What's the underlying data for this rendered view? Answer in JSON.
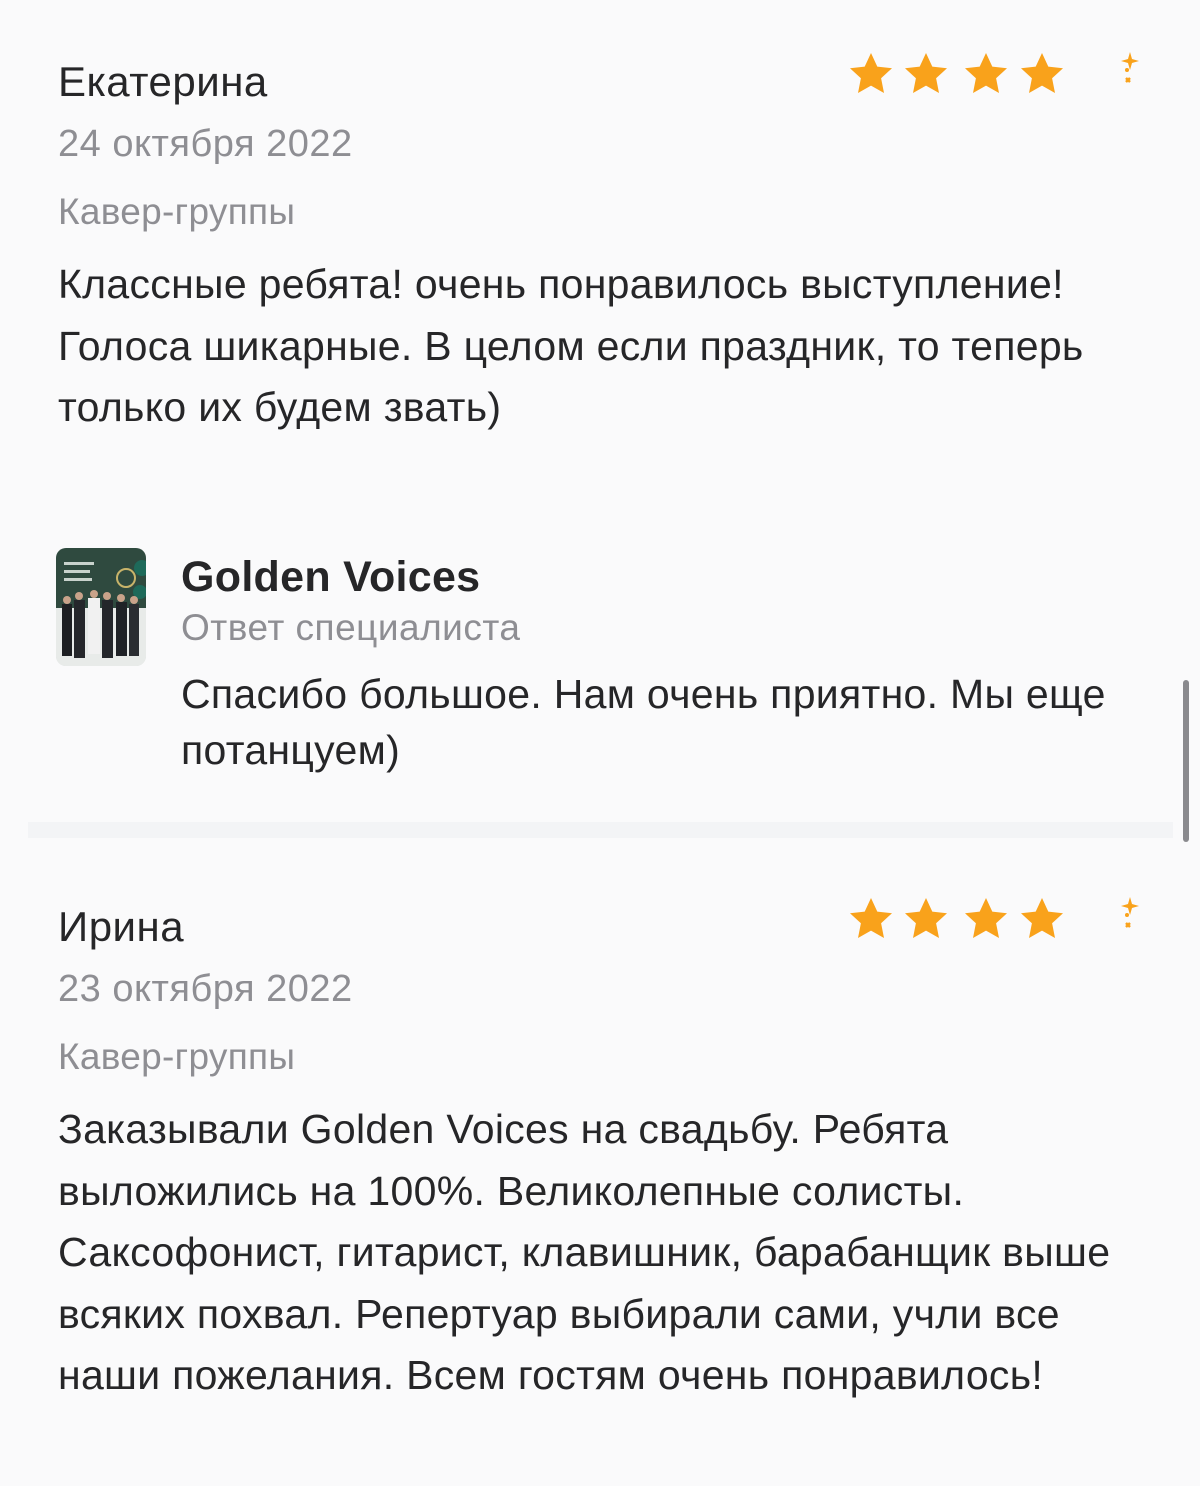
{
  "reviews": [
    {
      "author": "Екатерина",
      "date": "24 октября 2022",
      "category": "Кавер-группы",
      "rating": 4.5,
      "text": "Классные ребята! очень понравилось выступление! Голоса шикарные. В целом если праздник, то теперь только их будем звать)",
      "reply": {
        "name": "Golden Voices",
        "role": "Ответ специалиста",
        "text": "Спасибо большое. Нам очень приятно. Мы еще потанцуем)",
        "avatar_icon": "group-photo-avatar"
      }
    },
    {
      "author": "Ирина",
      "date": "23 октября 2022",
      "category": "Кавер-группы",
      "rating": 4.5,
      "text": "Заказывали Golden Voices на свадьбу. Ребята выложились на 100%. Великолепные солисты. Саксофонист, гитарист, клавишник, барабанщик выше всяких похвал. Репертуар выбирали сами, учли все наши пожелания. Всем гостям очень понравилось!"
    }
  ],
  "colors": {
    "star": "#f9a21b",
    "text_primary": "#262628",
    "text_secondary": "#8e8e93",
    "background": "#fafafb"
  }
}
